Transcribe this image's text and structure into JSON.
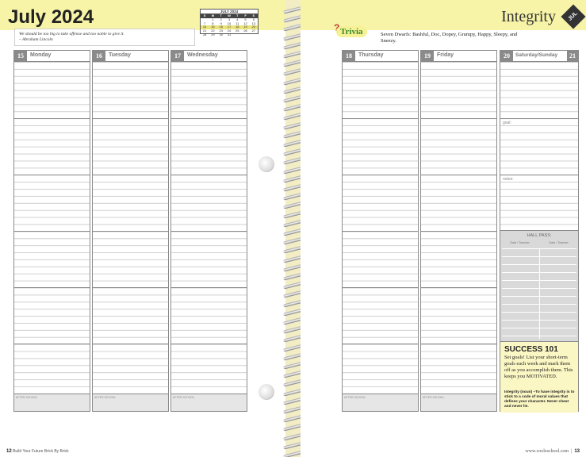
{
  "left": {
    "month_title": "July 2024",
    "quote": "We should be too big to take offense and too noble to give it.",
    "quote_author": "– Abraham Lincoln",
    "footer_page": "12",
    "footer_text": "Build Your Future Brick By Brick",
    "days": [
      {
        "num": "15",
        "name": "Monday"
      },
      {
        "num": "16",
        "name": "Tuesday"
      },
      {
        "num": "17",
        "name": "Wednesday"
      }
    ]
  },
  "mini_calendar": {
    "title": "JULY 2024",
    "weekdays": [
      "S",
      "M",
      "T",
      "W",
      "T",
      "F",
      "S"
    ],
    "weeks": [
      [
        "",
        "1",
        "2",
        "3",
        "4",
        "5",
        "6"
      ],
      [
        "7",
        "8",
        "9",
        "10",
        "11",
        "12",
        "13"
      ],
      [
        "14",
        "15",
        "16",
        "17",
        "18",
        "19",
        "20"
      ],
      [
        "21",
        "22",
        "23",
        "24",
        "25",
        "26",
        "27"
      ],
      [
        "28",
        "29",
        "30",
        "31",
        "",
        "",
        ""
      ]
    ],
    "highlight_week": 2
  },
  "right": {
    "theme_title": "Integrity",
    "tab_label": "JUL",
    "trivia_label": "Trivia",
    "trivia_text": "Seven Dwarfs: Bashful, Doc, Dopey, Grumpy, Happy, Sleepy, and Sneezy.",
    "days": [
      {
        "num": "18",
        "name": "Thursday"
      },
      {
        "num": "19",
        "name": "Friday"
      }
    ],
    "weekend": {
      "num": "20",
      "name": "Saturday/Sunday",
      "num2": "21"
    },
    "goal_label": "goal:",
    "notes_label": "notes:",
    "hall_pass": {
      "title": "HALL PASS:",
      "col1": "Date / Teacher",
      "col2": "Date / Teacher"
    },
    "success": {
      "title": "SUCCESS 101",
      "text": "Set goals! List your short-term goals each week and mark them off as you accomplish them. This keeps you MOTIVATED."
    },
    "definition": "Integrity (noun) –To have integrity is to stick to a code of moral values that defines your character. Never cheat and never lie.",
    "footer_url": "www.cooleschool.com",
    "footer_page": "13"
  },
  "labels": {
    "initial": "INITIAL:",
    "after_school": "AFTER SCHOOL:"
  }
}
